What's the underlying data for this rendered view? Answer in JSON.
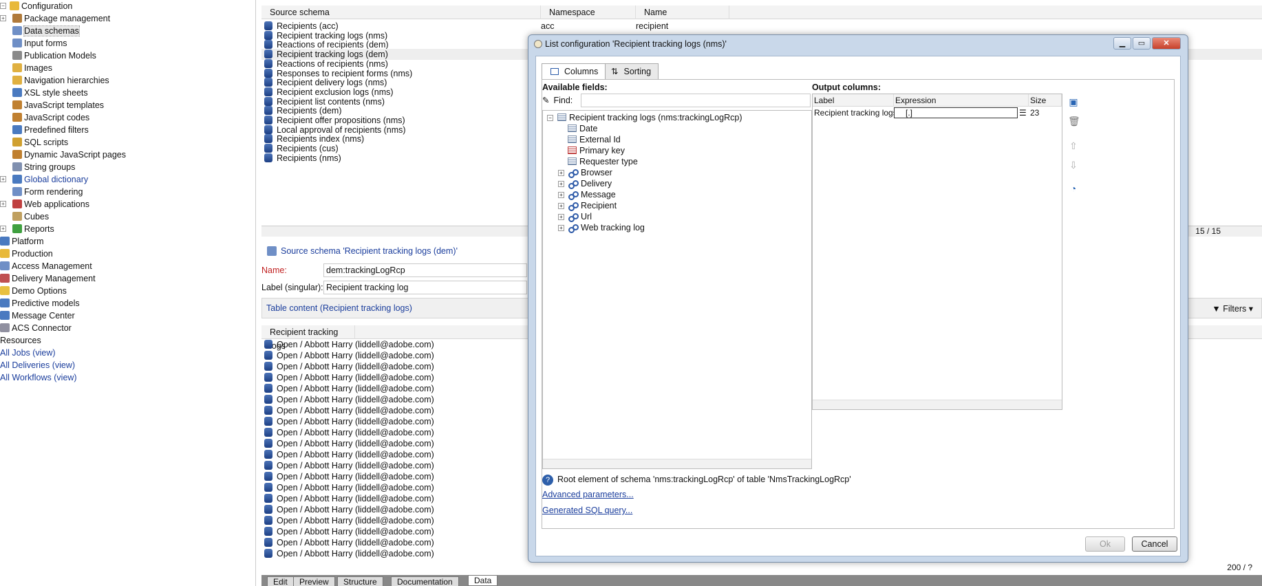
{
  "tree": {
    "items": [
      {
        "label": "Configuration",
        "level": 0,
        "expander": "-",
        "icon": "folder-icon",
        "color": "#e8b93a"
      },
      {
        "label": "Package management",
        "level": 1,
        "expander": "+",
        "icon": "package-icon",
        "color": "#b07a3a"
      },
      {
        "label": "Data schemas",
        "level": 1,
        "expander": "",
        "icon": "schema-icon",
        "color": "#6f8fc6",
        "selected": true
      },
      {
        "label": "Input forms",
        "level": 1,
        "expander": "",
        "icon": "form-icon",
        "color": "#6f8fc6"
      },
      {
        "label": "Publication Models",
        "level": 1,
        "expander": "",
        "icon": "publication-icon",
        "color": "#8a8a8a"
      },
      {
        "label": "Images",
        "level": 1,
        "expander": "",
        "icon": "image-icon",
        "color": "#e0b040"
      },
      {
        "label": "Navigation hierarchies",
        "level": 1,
        "expander": "",
        "icon": "navigation-icon",
        "color": "#e0b040"
      },
      {
        "label": "XSL style sheets",
        "level": 1,
        "expander": "",
        "icon": "xsl-icon",
        "color": "#4a7ac0"
      },
      {
        "label": "JavaScript templates",
        "level": 1,
        "expander": "",
        "icon": "js-template-icon",
        "color": "#c08030"
      },
      {
        "label": "JavaScript codes",
        "level": 1,
        "expander": "",
        "icon": "js-code-icon",
        "color": "#c08030"
      },
      {
        "label": "Predefined filters",
        "level": 1,
        "expander": "",
        "icon": "filter-icon",
        "color": "#4a7ac0"
      },
      {
        "label": "SQL scripts",
        "level": 1,
        "expander": "",
        "icon": "sql-icon",
        "color": "#d0a030"
      },
      {
        "label": "Dynamic JavaScript pages",
        "level": 1,
        "expander": "",
        "icon": "js-page-icon",
        "color": "#c08030"
      },
      {
        "label": "String groups",
        "level": 1,
        "expander": "",
        "icon": "string-icon",
        "color": "#8090b0"
      },
      {
        "label": "Global dictionary",
        "level": 1,
        "expander": "+",
        "icon": "dictionary-icon",
        "color": "#4a7ac0",
        "link": true
      },
      {
        "label": "Form rendering",
        "level": 1,
        "expander": "",
        "icon": "render-icon",
        "color": "#6f8fc6"
      },
      {
        "label": "Web applications",
        "level": 1,
        "expander": "+",
        "icon": "webapp-icon",
        "color": "#c04040"
      },
      {
        "label": "Cubes",
        "level": 1,
        "expander": "",
        "icon": "cube-icon",
        "color": "#c0a060"
      },
      {
        "label": "Reports",
        "level": 1,
        "expander": "+",
        "icon": "report-icon",
        "color": "#40a040"
      },
      {
        "label": "Platform",
        "level": 0,
        "expander": "",
        "icon": "folder-icon",
        "color": "#4a7ac0"
      },
      {
        "label": "Production",
        "level": 0,
        "expander": "",
        "icon": "folder-icon",
        "color": "#e8b93a"
      },
      {
        "label": "Access Management",
        "level": 0,
        "expander": "",
        "icon": "folder-icon",
        "color": "#6f8fc6"
      },
      {
        "label": "Delivery Management",
        "level": 0,
        "expander": "",
        "icon": "folder-icon",
        "color": "#c05050"
      },
      {
        "label": "Demo Options",
        "level": 0,
        "expander": "",
        "icon": "folder-icon",
        "color": "#e8c040"
      },
      {
        "label": "Predictive models",
        "level": 0,
        "expander": "",
        "icon": "folder-icon",
        "color": "#4a7ac0"
      },
      {
        "label": "Message Center",
        "level": 0,
        "expander": "",
        "icon": "folder-icon",
        "color": "#4a7ac0"
      },
      {
        "label": "ACS Connector",
        "level": 0,
        "expander": "",
        "icon": "folder-icon",
        "color": "#9090a0"
      },
      {
        "label": "Resources",
        "level": 0,
        "expander": "",
        "icon": "",
        "color": ""
      },
      {
        "label": "All Jobs (view)",
        "level": 0,
        "expander": "",
        "icon": "",
        "color": "",
        "link": true
      },
      {
        "label": "All Deliveries (view)",
        "level": 0,
        "expander": "",
        "icon": "",
        "color": "",
        "link": true
      },
      {
        "label": "All Workflows (view)",
        "level": 0,
        "expander": "",
        "icon": "",
        "color": "",
        "link": true
      }
    ]
  },
  "schema_list": {
    "columns": [
      "Source schema",
      "Namespace",
      "Name"
    ],
    "rows": [
      {
        "source": "Recipients (acc)",
        "namespace": "acc",
        "name": "recipient"
      },
      {
        "source": "Recipient tracking logs (nms)",
        "namespace": "",
        "name": ""
      },
      {
        "source": "Reactions of recipients (dem)",
        "namespace": "",
        "name": ""
      },
      {
        "source": "Recipient tracking logs (dem)",
        "namespace": "",
        "name": "",
        "selected": true
      },
      {
        "source": "Reactions of recipients (nms)",
        "namespace": "",
        "name": ""
      },
      {
        "source": "Responses to recipient forms (nms)",
        "namespace": "",
        "name": ""
      },
      {
        "source": "Recipient delivery logs (nms)",
        "namespace": "",
        "name": ""
      },
      {
        "source": "Recipient exclusion logs (nms)",
        "namespace": "",
        "name": ""
      },
      {
        "source": "Recipient list contents (nms)",
        "namespace": "",
        "name": ""
      },
      {
        "source": "Recipients (dem)",
        "namespace": "",
        "name": ""
      },
      {
        "source": "Recipient offer propositions (nms)",
        "namespace": "",
        "name": ""
      },
      {
        "source": "Local approval of recipients (nms)",
        "namespace": "",
        "name": ""
      },
      {
        "source": "Recipients index (nms)",
        "namespace": "",
        "name": ""
      },
      {
        "source": "Recipients (cus)",
        "namespace": "",
        "name": ""
      },
      {
        "source": "Recipients (nms)",
        "namespace": "",
        "name": ""
      }
    ],
    "count": "15 / 15"
  },
  "detail": {
    "header": "Source schema 'Recipient tracking logs (dem)'",
    "name_label": "Name:",
    "name_value": "dem:trackingLogRcp",
    "label_label": "Label (singular):",
    "label_value": "Recipient tracking log",
    "table_content": "Table content (Recipient tracking logs)",
    "filters": "Filters",
    "content_header": "Recipient tracking logs",
    "content_row": "Open / Abbott Harry (liddell@adobe.com)",
    "content_count": "200 / ?"
  },
  "bottom_tabs": [
    "Edit",
    "Preview",
    "Structure",
    "Documentation",
    "Data"
  ],
  "dialog": {
    "title": "List configuration 'Recipient tracking logs (nms)'",
    "tabs": [
      "Columns",
      "Sorting"
    ],
    "available_fields_label": "Available fields:",
    "find_label": "Find:",
    "find_value": "",
    "fields_root": "Recipient tracking logs (nms:trackingLogRcp)",
    "fields": [
      {
        "label": "Date",
        "kind": "field"
      },
      {
        "label": "External Id",
        "kind": "field"
      },
      {
        "label": "Primary key",
        "kind": "key"
      },
      {
        "label": "Requester type",
        "kind": "field"
      },
      {
        "label": "Browser",
        "kind": "link"
      },
      {
        "label": "Delivery",
        "kind": "link"
      },
      {
        "label": "Message",
        "kind": "link"
      },
      {
        "label": "Recipient",
        "kind": "link"
      },
      {
        "label": "Url",
        "kind": "link"
      },
      {
        "label": "Web tracking log",
        "kind": "link"
      }
    ],
    "output_columns_label": "Output columns:",
    "output_headers": [
      "Label",
      "Expression",
      "Size"
    ],
    "output_rows": [
      {
        "label": "Recipient tracking logs",
        "expression": "[.]",
        "size": "23"
      }
    ],
    "info_text": "Root element of schema 'nms:trackingLogRcp' of table 'NmsTrackingLogRcp'",
    "advanced_link": "Advanced parameters...",
    "sql_link": "Generated SQL query...",
    "ok_label": "Ok",
    "cancel_label": "Cancel"
  }
}
